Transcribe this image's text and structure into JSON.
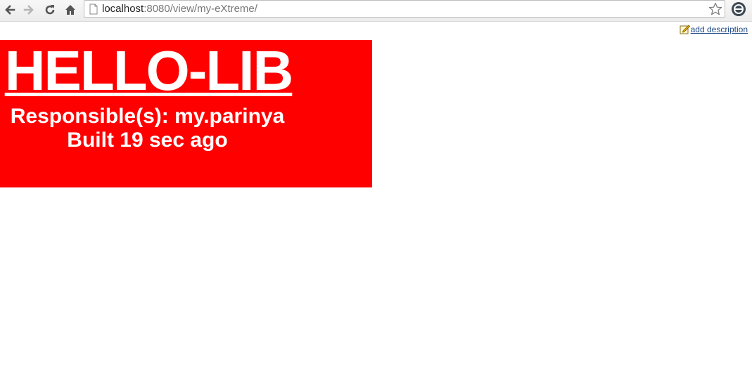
{
  "browser": {
    "url_host": "localhost",
    "url_rest": ":8080/view/my-eXtreme/"
  },
  "page": {
    "add_description_label": "add description",
    "radiator": {
      "job_name": "HELLO-LIB",
      "responsible": "Responsible(s): my.parinya",
      "built": "Built 19 sec ago",
      "status_color": "#ff0000"
    }
  },
  "icons": {
    "back": "back-arrow-icon",
    "forward": "forward-arrow-icon",
    "reload": "reload-icon",
    "home": "home-icon",
    "page": "page-icon",
    "bookmark": "star-icon",
    "extension": "extension-icon",
    "edit": "edit-description-icon"
  }
}
